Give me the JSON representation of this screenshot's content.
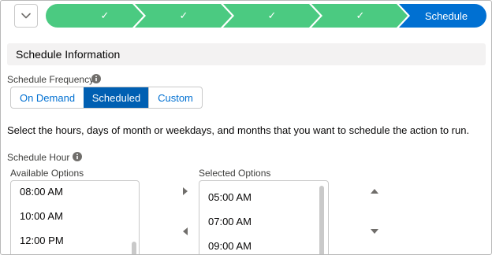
{
  "path": {
    "completed_stages": [
      "✓",
      "✓",
      "✓",
      "✓"
    ],
    "current_stage": "Schedule",
    "complete_color": "#4bca81",
    "current_color": "#0070d2"
  },
  "section": {
    "title": "Schedule Information"
  },
  "frequency": {
    "label": "Schedule Frequency",
    "options": [
      "On Demand",
      "Scheduled",
      "Custom"
    ],
    "selected": "Scheduled"
  },
  "instructions": "Select the hours, days of month or weekdays, and months that you want to schedule the action to run.",
  "schedule_hour": {
    "label": "Schedule Hour",
    "available": {
      "label": "Available Options",
      "items": [
        "08:00 AM",
        "10:00 AM",
        "12:00 PM"
      ]
    },
    "selected": {
      "label": "Selected Options",
      "items": [
        "05:00 AM",
        "07:00 AM",
        "09:00 AM"
      ]
    }
  }
}
